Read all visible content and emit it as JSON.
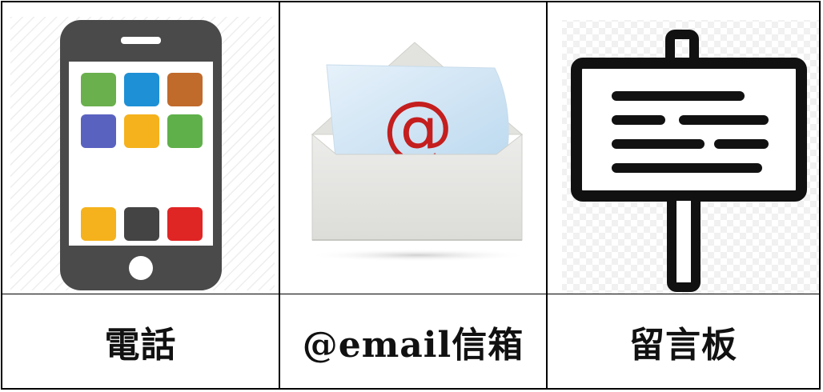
{
  "items": [
    {
      "icon": "smartphone-icon",
      "label": "電話"
    },
    {
      "icon": "email-envelope-icon",
      "label": "@email信箱"
    },
    {
      "icon": "message-board-icon",
      "label": "留言板"
    }
  ],
  "colors": {
    "border": "#000000",
    "phone_body": "#4a4a4a",
    "app_green": "#6ab04c",
    "app_blue": "#1e90d6",
    "app_brown": "#c06a2b",
    "app_indigo": "#5a62c0",
    "app_yellow": "#f5b21c",
    "app_dark": "#444444",
    "app_red": "#e02525",
    "at_sign": "#c41e1e"
  }
}
